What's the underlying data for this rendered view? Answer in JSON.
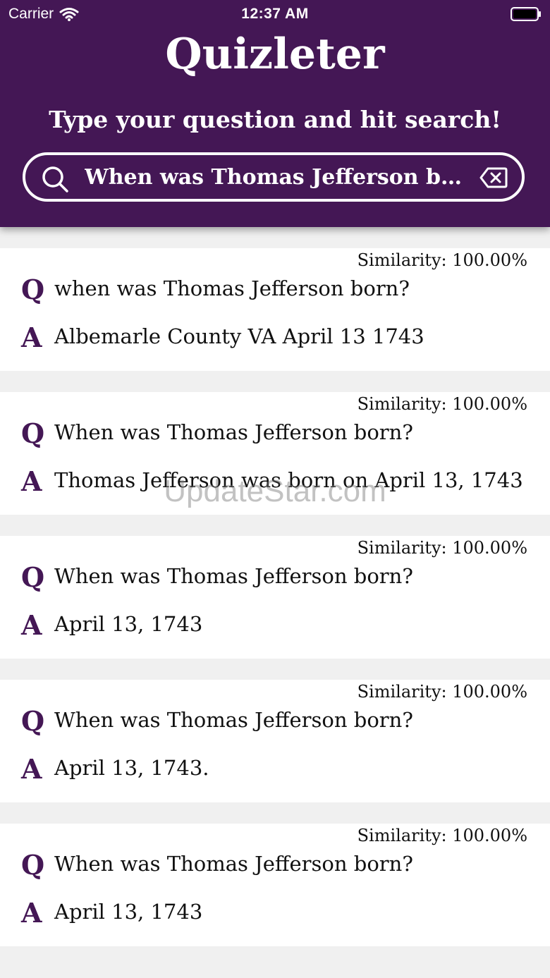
{
  "status_bar": {
    "carrier": "Carrier",
    "time": "12:37 AM"
  },
  "app": {
    "title": "Quizleter",
    "subtitle": "Type your question and hit search!",
    "accent_color": "#441755"
  },
  "search": {
    "value": "When was Thomas Jefferson born?",
    "search_icon": "search-icon",
    "clear_icon": "clear-icon"
  },
  "results": [
    {
      "similarity": "Similarity: 100.00%",
      "q_label": "Q",
      "question": "when was Thomas Jefferson born?",
      "a_label": "A",
      "answer": "Albemarle County VA April 13 1743"
    },
    {
      "similarity": "Similarity: 100.00%",
      "q_label": "Q",
      "question": "When was Thomas Jefferson born?",
      "a_label": "A",
      "answer": "Thomas Jefferson was born on April 13, 1743"
    },
    {
      "similarity": "Similarity: 100.00%",
      "q_label": "Q",
      "question": "When was Thomas Jefferson born?",
      "a_label": "A",
      "answer": "April 13, 1743"
    },
    {
      "similarity": "Similarity: 100.00%",
      "q_label": "Q",
      "question": "When was Thomas Jefferson born?",
      "a_label": "A",
      "answer": "April 13, 1743."
    },
    {
      "similarity": "Similarity: 100.00%",
      "q_label": "Q",
      "question": "When was Thomas Jefferson born?",
      "a_label": "A",
      "answer": "April 13, 1743"
    }
  ],
  "watermark": "UpdateStar.com"
}
